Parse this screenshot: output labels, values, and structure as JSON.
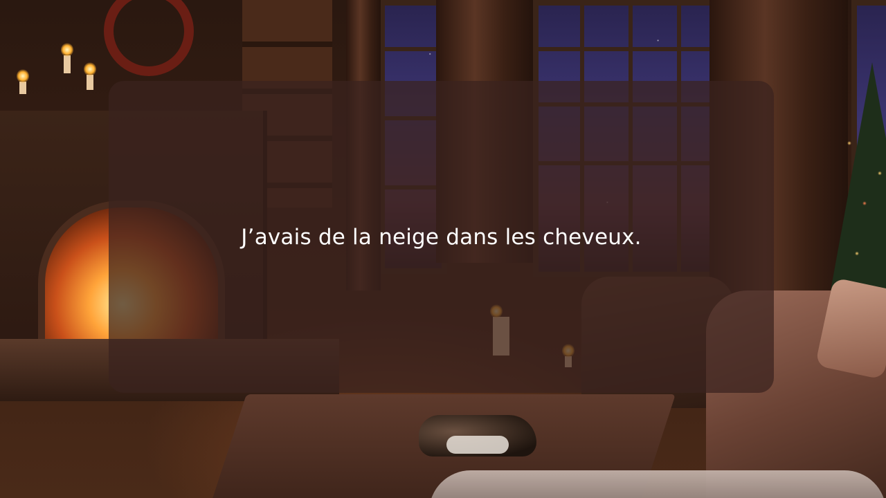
{
  "scene": {
    "icon": "cozy-winter-room-background"
  },
  "caption": {
    "text": "J’avais de la neige dans les cheveux."
  },
  "colors": {
    "card_background": "#3a221e",
    "caption_text": "#ffffff"
  }
}
